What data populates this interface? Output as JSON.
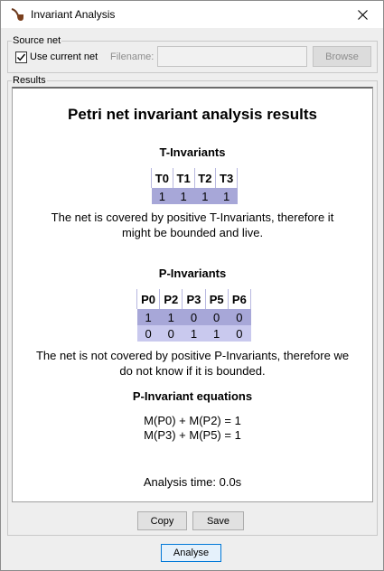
{
  "window": {
    "title": "Invariant Analysis",
    "app_icon": "pipe-icon",
    "close_icon": "close-icon"
  },
  "source_net": {
    "legend": "Source net",
    "use_current_label": "Use current net",
    "use_current_checked": true,
    "filename_label": "Filename:",
    "filename_value": "",
    "browse_label": "Browse"
  },
  "results": {
    "legend": "Results",
    "title": "Petri net invariant analysis results",
    "t_invariants": {
      "heading": "T-Invariants",
      "columns": [
        "T0",
        "T1",
        "T2",
        "T3"
      ],
      "rows": [
        [
          "1",
          "1",
          "1",
          "1"
        ]
      ],
      "note_line1": "The net is covered by positive T-Invariants, therefore it",
      "note_line2": "might be bounded and live."
    },
    "p_invariants": {
      "heading": "P-Invariants",
      "columns": [
        "P0",
        "P2",
        "P3",
        "P5",
        "P6"
      ],
      "rows": [
        [
          "1",
          "1",
          "0",
          "0",
          "0"
        ],
        [
          "0",
          "0",
          "1",
          "1",
          "0"
        ]
      ],
      "note_line1": "The net is not covered by positive P-Invariants, therefore we",
      "note_line2": "do not know if it is bounded."
    },
    "equations": {
      "heading": "P-Invariant equations",
      "lines": [
        "M(P0) + M(P2) = 1",
        "M(P3) + M(P5) = 1"
      ]
    },
    "analysis_time": "Analysis time: 0.0s",
    "copy_label": "Copy",
    "save_label": "Save"
  },
  "analyse_label": "Analyse",
  "colors": {
    "row_dark": "#a7a7d8",
    "row_light": "#c9c9ee",
    "focus_blue": "#0078d7"
  }
}
